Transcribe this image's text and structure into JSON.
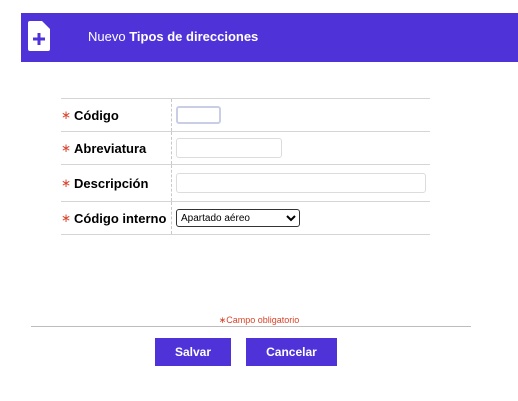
{
  "header": {
    "prefix": "Nuevo",
    "title": "Tipos de direcciones",
    "icon": "add-document-icon",
    "color": "#4f33d9"
  },
  "form": {
    "required_marker": "∗",
    "fields": [
      {
        "label": "Código",
        "value": ""
      },
      {
        "label": "Abreviatura",
        "value": ""
      },
      {
        "label": "Descripción",
        "value": ""
      },
      {
        "label": "Código interno",
        "value": "Apartado aéreo"
      }
    ]
  },
  "note": "∗Campo obligatorio",
  "buttons": {
    "save": "Salvar",
    "cancel": "Cancelar"
  }
}
